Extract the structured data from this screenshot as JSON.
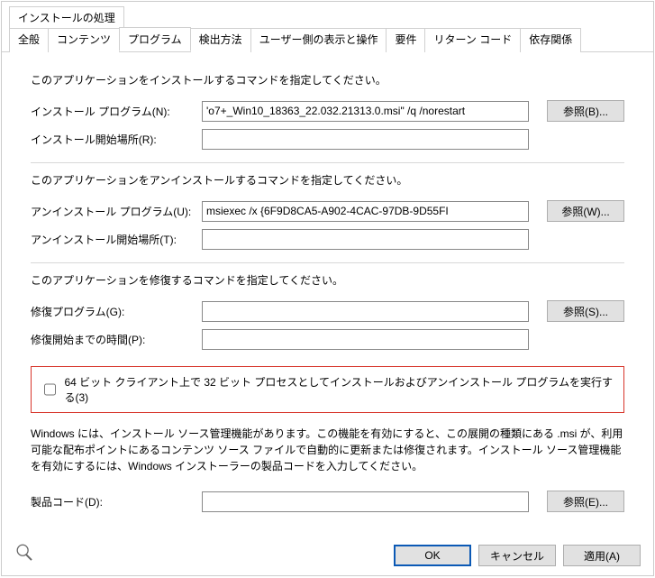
{
  "tabs": {
    "row1": [
      "インストールの処理"
    ],
    "row2": [
      "全般",
      "コンテンツ",
      "プログラム",
      "検出方法",
      "ユーザー側の表示と操作",
      "要件",
      "リターン コード",
      "依存関係"
    ],
    "selected": "プログラム"
  },
  "install": {
    "sectionLabel": "このアプリケーションをインストールするコマンドを指定してください。",
    "programLabel": "インストール プログラム(N):",
    "programValue": "'o7+_Win10_18363_22.032.21313.0.msi\" /q /norestart",
    "startLabel": "インストール開始場所(R):",
    "startValue": "",
    "browseLabel": "参照(B)..."
  },
  "uninstall": {
    "sectionLabel": "このアプリケーションをアンインストールするコマンドを指定してください。",
    "programLabel": "アンインストール プログラム(U):",
    "programValue": "msiexec /x {6F9D8CA5-A902-4CAC-97DB-9D55FI",
    "startLabel": "アンインストール開始場所(T):",
    "startValue": "",
    "browseLabel": "参照(W)..."
  },
  "repair": {
    "sectionLabel": "このアプリケーションを修復するコマンドを指定してください。",
    "programLabel": "修復プログラム(G):",
    "programValue": "",
    "timeLabel": "修復開始までの時間(P):",
    "timeValue": "",
    "browseLabel": "参照(S)..."
  },
  "checkbox": {
    "label": "64 ビット クライアント上で 32 ビット プロセスとしてインストールおよびアンインストール プログラムを実行する(3)",
    "checked": false
  },
  "info": "Windows には、インストール ソース管理機能があります。この機能を有効にすると、この展開の種類にある .msi が、利用可能な配布ポイントにあるコンテンツ ソース ファイルで自動的に更新または修復されます。インストール ソース管理機能を有効にするには、Windows インストーラーの製品コードを入力してください。",
  "productCode": {
    "label": "製品コード(D):",
    "value": "",
    "browseLabel": "参照(E)..."
  },
  "footer": {
    "ok": "OK",
    "cancel": "キャンセル",
    "apply": "適用(A)"
  }
}
